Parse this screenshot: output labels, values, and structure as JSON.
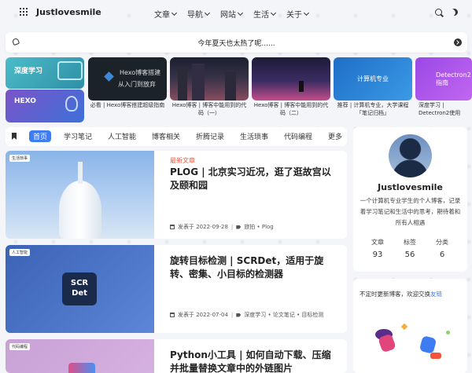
{
  "brand": "Justlovesmile",
  "menu": [
    "文章",
    "导航",
    "网站",
    "生活",
    "关于"
  ],
  "notice": "今年夏天也太热了呢......",
  "categories": [
    {
      "label": "深度学习",
      "color": "#3aa9bd"
    },
    {
      "label": "HEXO",
      "color": "#5b5fd0"
    }
  ],
  "featured": [
    {
      "title": "必看 | Hexo博客搭建超级指南",
      "thumb_text": "Hexo博客搭建",
      "thumb_text2": "从入门到放弃"
    },
    {
      "title": "Hexo博客 | 博客中能用到的代码（一）"
    },
    {
      "title": "Hexo博客 | 博客中能用到的代码（二）"
    },
    {
      "title": "推荐 | 计算机专业，大学课程「笔记归档」",
      "thumb_text": "计算机专业"
    },
    {
      "title": "深度学习 | Detectron2使用",
      "thumb_text": "Detectron2指南"
    }
  ],
  "tabs": [
    "首页",
    "学习笔记",
    "人工智能",
    "博客相关",
    "折腾记录",
    "生活琐事",
    "代码编程",
    "更多"
  ],
  "articles": [
    {
      "tag": "生活琐事",
      "badge": "最新文章",
      "title": "PLOG | 北京实习近况，逛了逛故宫以及颐和园",
      "date": "发表于 2022-09-28",
      "categories": "旅拍 • Plog"
    },
    {
      "tag": "人工智能",
      "title": "旋转目标检测 | SCRDet，适用于旋转、密集、小目标的检测器",
      "date": "发表于 2022-07-04",
      "categories": "深度学习 • 论文笔记 • 目标检测",
      "thumb_logo": "SCR Det"
    },
    {
      "tag": "代码编程",
      "title": "Python小工具 | 如何自动下载、压缩并批量替换文章中的外链图片"
    }
  ],
  "profile": {
    "name": "Justlovesmile",
    "bio": "一个计算机专业学生的个人博客，记录着学习笔记和生活中的思考，期待着和所有人相遇",
    "stats": [
      {
        "label": "文章",
        "value": "93"
      },
      {
        "label": "标签",
        "value": "56"
      },
      {
        "label": "分类",
        "value": "6"
      }
    ]
  },
  "friend": {
    "text": "不定时更新博客，欢迎交换",
    "link": "友链"
  }
}
